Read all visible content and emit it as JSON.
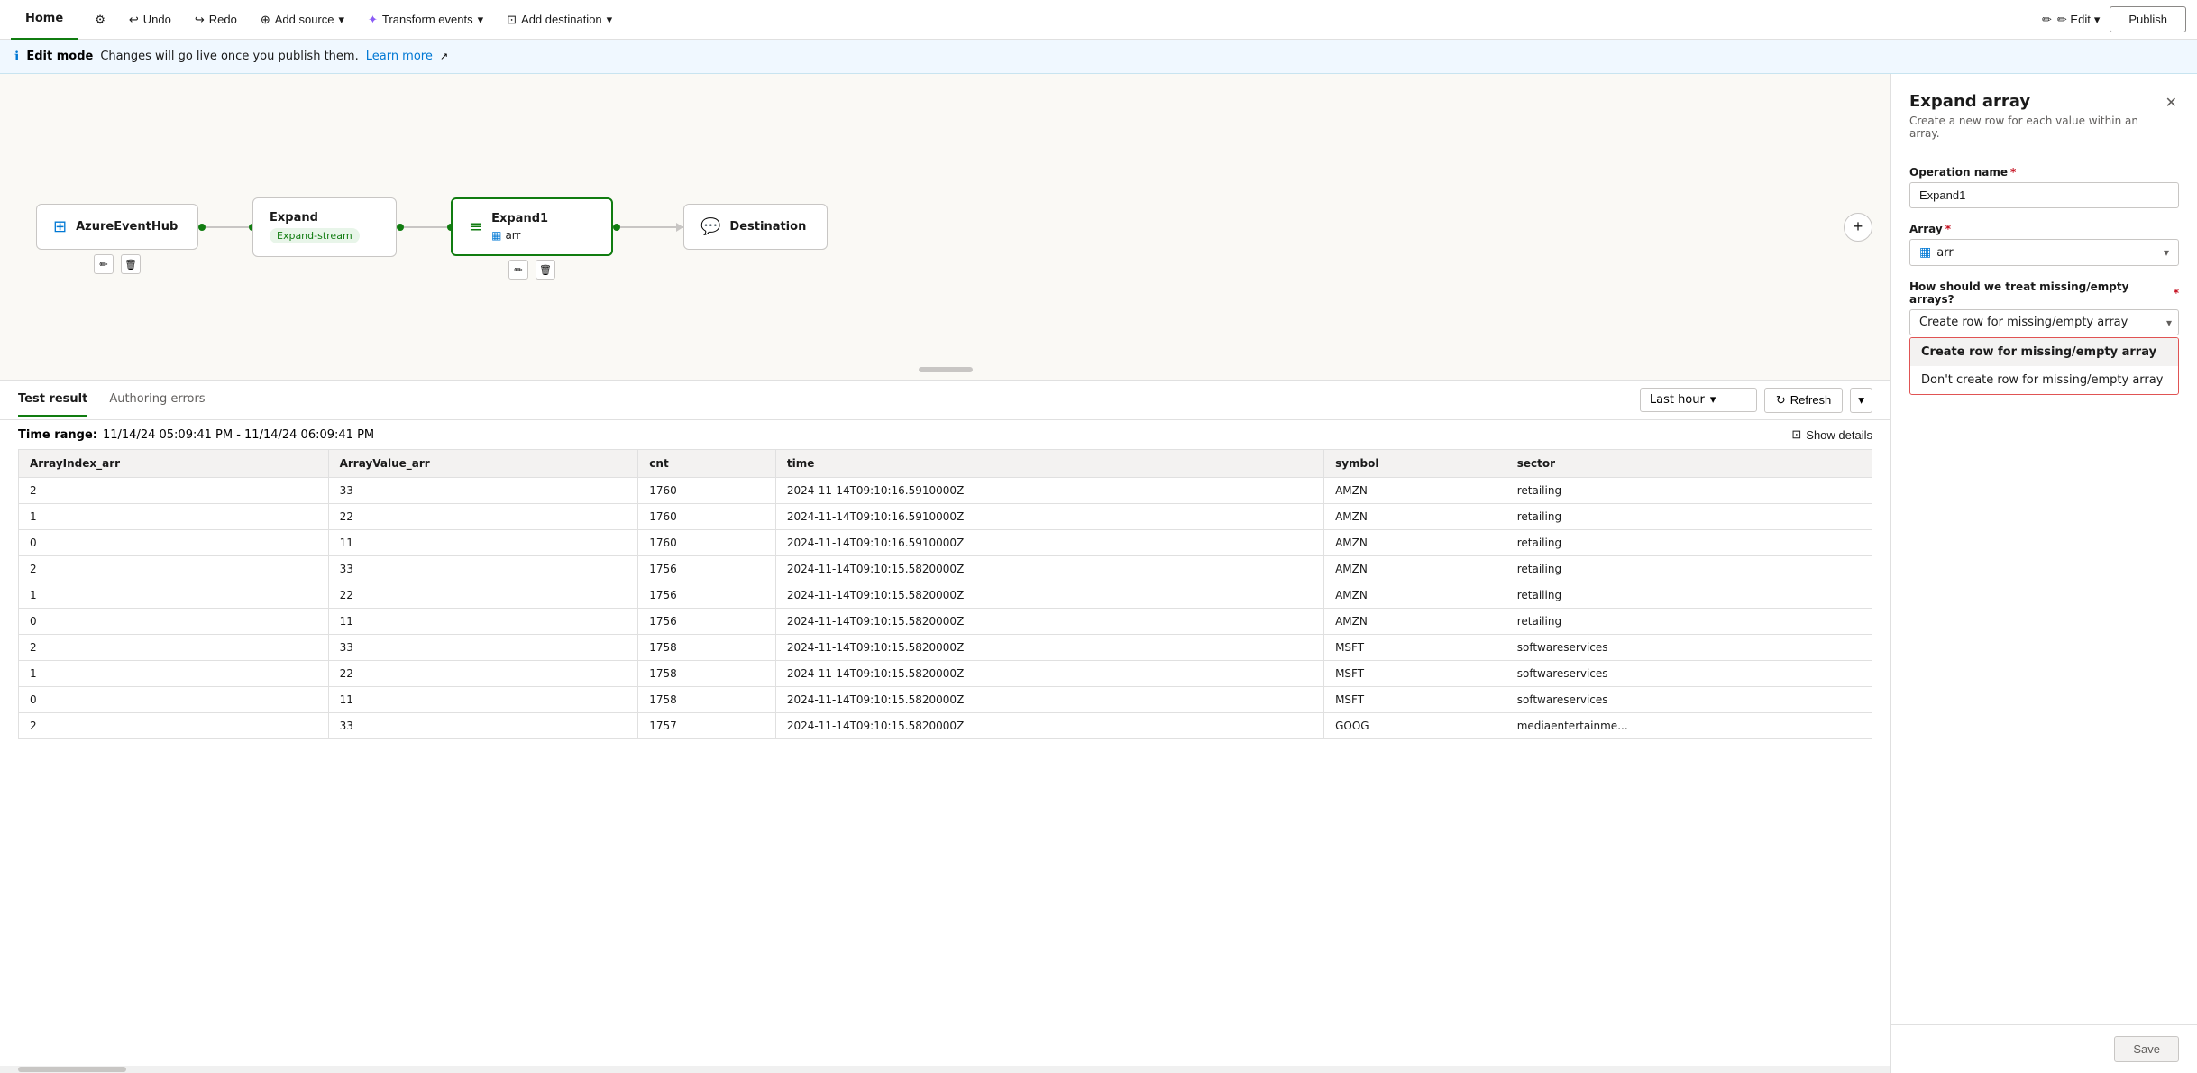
{
  "topbar": {
    "home_tab": "Home",
    "edit_label": "✏ Edit",
    "undo_label": "Undo",
    "redo_label": "Redo",
    "add_source_label": "Add source",
    "transform_events_label": "Transform events",
    "add_destination_label": "Add destination",
    "publish_label": "Publish"
  },
  "infobar": {
    "mode_label": "Edit mode",
    "message": "Changes will go live once you publish them.",
    "learn_more": "Learn more"
  },
  "nodes": {
    "azure": {
      "label": "AzureEventHub",
      "icon": "⊞"
    },
    "expand": {
      "label": "Expand",
      "sublabel": "Expand-stream"
    },
    "expand1": {
      "label": "Expand1",
      "sublabel": "arr"
    },
    "destination": {
      "label": "Destination",
      "icon": "💬"
    }
  },
  "panel": {
    "title": "Expand array",
    "description": "Create a new row for each value within an array.",
    "operation_name_label": "Operation name",
    "operation_name_value": "Expand1",
    "array_label": "Array",
    "array_value": "arr",
    "treatment_label": "How should we treat missing/empty arrays?",
    "treatment_value": "Create row for missing/empty array",
    "dropdown_options": [
      "Create row for missing/empty array",
      "Don't create row for missing/empty array"
    ],
    "save_label": "Save"
  },
  "test_area": {
    "tab_test_result": "Test result",
    "tab_authoring_errors": "Authoring errors",
    "time_range_label": "Last hour",
    "refresh_label": "Refresh",
    "show_details_label": "Show details",
    "time_range_text": "Time range:",
    "time_range_value": "11/14/24 05:09:41 PM - 11/14/24 06:09:41 PM",
    "table": {
      "columns": [
        "ArrayIndex_arr",
        "ArrayValue_arr",
        "cnt",
        "time",
        "symbol",
        "sector"
      ],
      "rows": [
        [
          "2",
          "33",
          "1760",
          "2024-11-14T09:10:16.5910000Z",
          "AMZN",
          "retailing"
        ],
        [
          "1",
          "22",
          "1760",
          "2024-11-14T09:10:16.5910000Z",
          "AMZN",
          "retailing"
        ],
        [
          "0",
          "11",
          "1760",
          "2024-11-14T09:10:16.5910000Z",
          "AMZN",
          "retailing"
        ],
        [
          "2",
          "33",
          "1756",
          "2024-11-14T09:10:15.5820000Z",
          "AMZN",
          "retailing"
        ],
        [
          "1",
          "22",
          "1756",
          "2024-11-14T09:10:15.5820000Z",
          "AMZN",
          "retailing"
        ],
        [
          "0",
          "11",
          "1756",
          "2024-11-14T09:10:15.5820000Z",
          "AMZN",
          "retailing"
        ],
        [
          "2",
          "33",
          "1758",
          "2024-11-14T09:10:15.5820000Z",
          "MSFT",
          "softwareservices"
        ],
        [
          "1",
          "22",
          "1758",
          "2024-11-14T09:10:15.5820000Z",
          "MSFT",
          "softwareservices"
        ],
        [
          "0",
          "11",
          "1758",
          "2024-11-14T09:10:15.5820000Z",
          "MSFT",
          "softwareservices"
        ],
        [
          "2",
          "33",
          "1757",
          "2024-11-14T09:10:15.5820000Z",
          "GOOG",
          "mediaentertainme..."
        ]
      ]
    }
  }
}
